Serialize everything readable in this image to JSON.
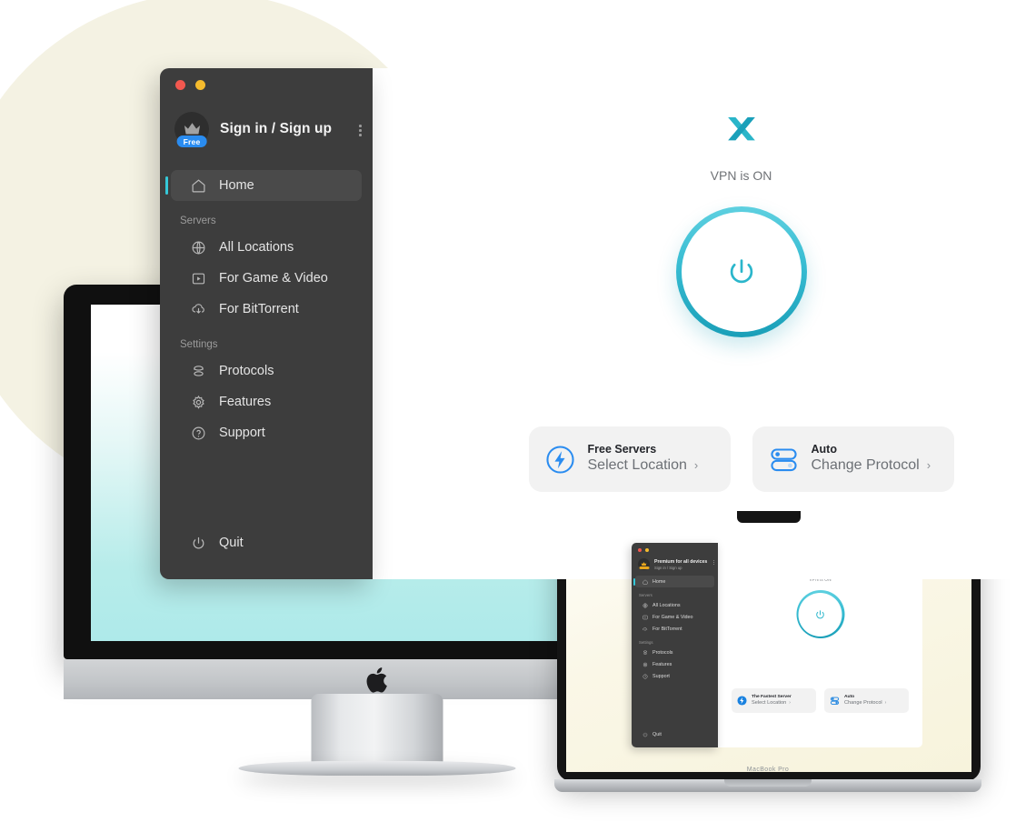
{
  "app": {
    "window_controls": [
      "close",
      "minimize"
    ],
    "account": {
      "title": "Sign in / Sign up",
      "badge": "Free",
      "avatar_icon": "crown-icon",
      "menu_icon": "kebab-menu-icon"
    },
    "sidebar": {
      "primary": [
        {
          "label": "Home",
          "icon": "home-icon",
          "active": true
        }
      ],
      "groups": [
        {
          "title": "Servers",
          "items": [
            {
              "label": "All Locations",
              "icon": "globe-icon"
            },
            {
              "label": "For Game & Video",
              "icon": "video-play-icon"
            },
            {
              "label": "For BitTorrent",
              "icon": "cloud-download-icon"
            }
          ]
        },
        {
          "title": "Settings",
          "items": [
            {
              "label": "Protocols",
              "icon": "layers-icon"
            },
            {
              "label": "Features",
              "icon": "gear-icon"
            },
            {
              "label": "Support",
              "icon": "question-circle-icon"
            }
          ]
        }
      ],
      "footer": {
        "label": "Quit",
        "icon": "power-icon"
      }
    },
    "main": {
      "logo_icon": "x-vpn-logo",
      "status_text": "VPN is ON",
      "power_button_icon": "power-icon",
      "cards": [
        {
          "icon": "lightning-bolt-circle-icon",
          "title": "Free Servers",
          "subtitle": "Select Location",
          "chevron": "›"
        },
        {
          "icon": "protocol-toggles-icon",
          "title": "Auto",
          "subtitle": "Change Protocol",
          "chevron": "›"
        }
      ]
    }
  },
  "laptop": {
    "device_label": "MacBook Pro",
    "app": {
      "account": {
        "title": "Premium for all devices",
        "subtitle": "Sign in / Sign up",
        "avatar_icon": "crown-icon",
        "menu_icon": "kebab-menu-icon"
      },
      "sidebar": {
        "primary": [
          {
            "label": "Home",
            "icon": "home-icon",
            "active": true
          }
        ],
        "groups": [
          {
            "title": "Servers",
            "items": [
              {
                "label": "All Locations",
                "icon": "globe-icon"
              },
              {
                "label": "For Game & Video",
                "icon": "video-play-icon"
              },
              {
                "label": "For BitTorrent",
                "icon": "cloud-download-icon"
              }
            ]
          },
          {
            "title": "Settings",
            "items": [
              {
                "label": "Protocols",
                "icon": "layers-icon"
              },
              {
                "label": "Features",
                "icon": "gear-icon"
              },
              {
                "label": "Support",
                "icon": "question-circle-icon"
              }
            ]
          }
        ],
        "footer": {
          "label": "Quit",
          "icon": "power-icon"
        }
      },
      "main": {
        "logo_icon": "x-vpn-logo",
        "status_text": "VPN is ON",
        "cards": [
          {
            "icon": "lightning-bolt-filled-icon",
            "title": "The Fastest Server",
            "subtitle": "Select Location",
            "chevron": "›"
          },
          {
            "icon": "protocol-toggles-icon",
            "title": "Auto",
            "subtitle": "Change Protocol",
            "chevron": "›"
          }
        ]
      }
    }
  },
  "desktop": {
    "device_brand_icon": "apple-logo"
  },
  "colors": {
    "accent_teal": "#35c8d8",
    "accent_blue": "#2a8cf0",
    "sidebar_dark": "#3d3d3d",
    "cream": "#f4f2e3",
    "card_gray": "#f2f2f2"
  }
}
